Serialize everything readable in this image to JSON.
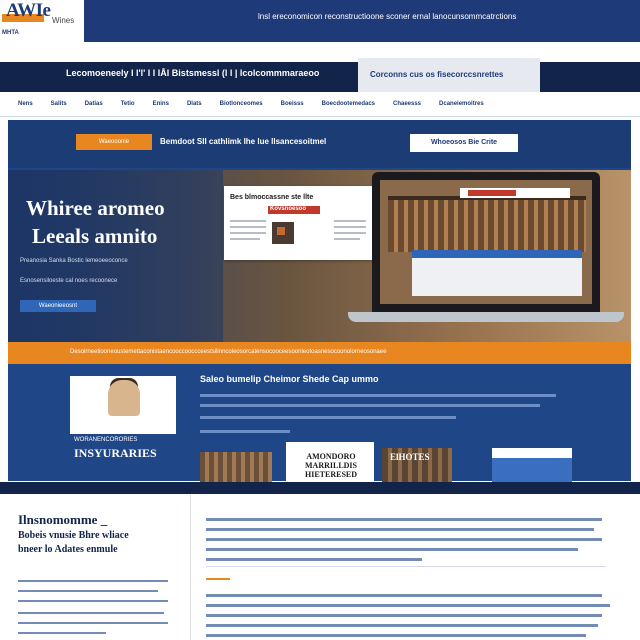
{
  "header": {
    "logo_text": "AWIe",
    "logo_sub": "Wines",
    "logo_tagline": "MHTA",
    "top_tagline": "lnsl ereconomicon reconstructioone sconer ernal lanocunsommcatrctions"
  },
  "banner": {
    "dark_text": "Lecomoeneely l l'l' l l lÅl Bistsmessl (l l | lcolcommmaraeoo",
    "light_text": "Corconns cus os fisecorccsnrettes"
  },
  "nav": {
    "items": [
      "Nens",
      "Salits",
      "Datias",
      "Tetio",
      "Enins",
      "Dlats",
      "Biotlonceomes",
      "Boeisss",
      "Boecdootemedacs",
      "Chaeesss",
      "Dcaneiemoitres"
    ]
  },
  "hero": {
    "orange_button": "Waeooonie",
    "strip_title": "Bemdoot SII cathlimk lhe lue llsancesoitmel",
    "white_button": "Whoeosos Bie Crite",
    "title_line1": "Whiree aromeo",
    "title_line2": "Leeals amnito",
    "sub_line1": "Preanosia Sanka Bostic lemeoeeoconce",
    "sub_line2": "Esnosensiloeste cal noes recoonece",
    "cta": "Waeonieeosnt",
    "doc_heading": "Bes blmoccassne ste llte",
    "doc_red": "Kovsnoesoo",
    "orange_band": "Desoirneetiooneoustemettaconistaencooccooccceestsilinncoleosorcatensocooceesoonleotoasnesocoonolorneosonaee"
  },
  "section2": {
    "heading": "Saleo bumelip Cheimor Shede Cap ummo",
    "portrait_banner_top": "WORANENCORORIES",
    "portrait_banner_big": "INSYURARIES",
    "thumb2_text": "AMONDORO MARRILLDIS HIETERESED",
    "thumb3_text": "ElHOTES"
  },
  "lower": {
    "title": "Ilnsnomomme _",
    "sub1": "Bobeis vnusie Bhre wliace",
    "sub2": "bneer lo Adates enmule"
  },
  "colors": {
    "navy": "#1f3a78",
    "dark_navy": "#12244a",
    "hero_blue": "#1f4686",
    "orange": "#e8861f",
    "red": "#c0392b"
  }
}
